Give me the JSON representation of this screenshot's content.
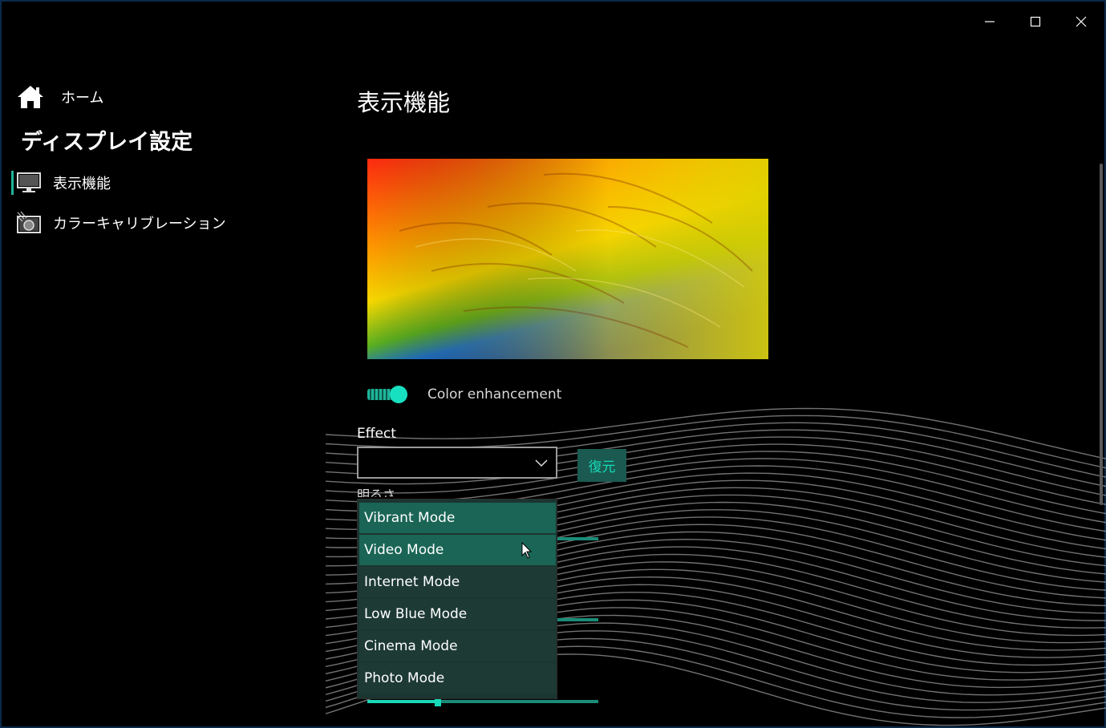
{
  "window": {
    "controls": {
      "minimize": "minimize-icon",
      "maximize": "maximize-icon",
      "close": "close-icon"
    }
  },
  "sidebar": {
    "home_label": "ホーム",
    "heading": "ディスプレイ設定",
    "items": [
      {
        "label": "表示機能",
        "icon": "monitor-icon",
        "active": true
      },
      {
        "label": "カラーキャリブレーション",
        "icon": "calibration-icon",
        "active": false
      }
    ]
  },
  "main": {
    "title": "表示機能",
    "color_enhancement": {
      "label": "Color enhancement",
      "on": true
    },
    "effect": {
      "label": "Effect",
      "selected": "",
      "options": [
        "Vibrant Mode",
        "Video Mode",
        "Internet Mode",
        "Low Blue Mode",
        "Cinema Mode",
        "Photo Mode"
      ],
      "highlighted": [
        "Vibrant Mode",
        "Video Mode"
      ]
    },
    "restore_label": "復元",
    "partial_label": "明るさ"
  },
  "colors": {
    "accent": "#17d9b8",
    "accent_dark": "#1a5a50",
    "dropdown_bg": "#1d3a35",
    "dropdown_hl": "#1a6556"
  }
}
